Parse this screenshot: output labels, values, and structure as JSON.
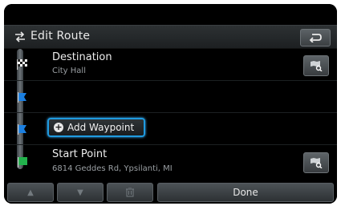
{
  "header": {
    "title": "Edit Route"
  },
  "route": {
    "destination": {
      "label": "Destination",
      "address": "City Hall"
    },
    "add_waypoint": {
      "label": "Add Waypoint"
    },
    "start_point": {
      "label": "Start Point",
      "address": "6814 Geddes Rd, Ypsilanti, MI"
    }
  },
  "toolbar": {
    "up_label": "▲",
    "down_label": "▼",
    "delete_label": "🗑",
    "done_label": "Done"
  },
  "colors": {
    "focus_blue": "#1f9be0",
    "flag_blue": "#1b7fe0",
    "flag_green": "#22b14c"
  }
}
